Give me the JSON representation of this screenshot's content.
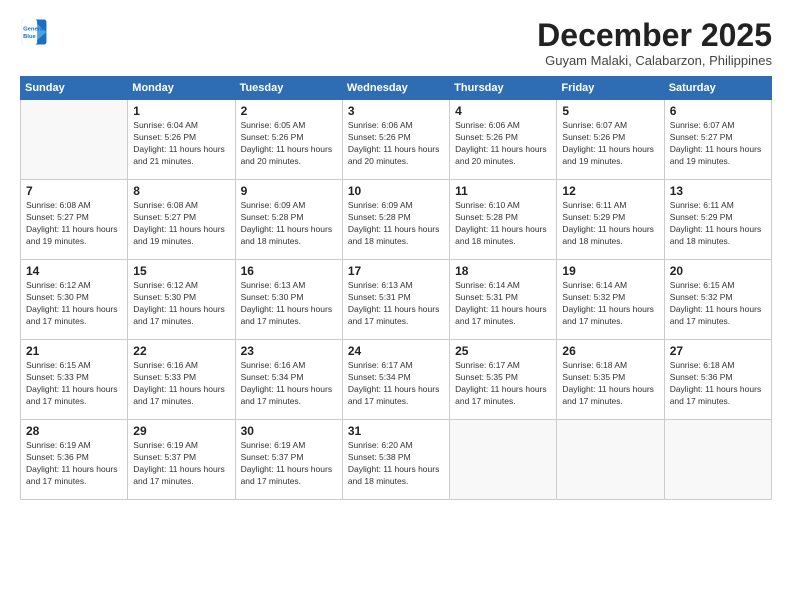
{
  "header": {
    "logo": {
      "line1": "General",
      "line2": "Blue"
    },
    "title": "December 2025",
    "location": "Guyam Malaki, Calabarzon, Philippines"
  },
  "columns": [
    "Sunday",
    "Monday",
    "Tuesday",
    "Wednesday",
    "Thursday",
    "Friday",
    "Saturday"
  ],
  "weeks": [
    [
      {
        "day": null
      },
      {
        "day": "1",
        "sunrise": "6:04 AM",
        "sunset": "5:26 PM",
        "daylight": "11 hours and 21 minutes."
      },
      {
        "day": "2",
        "sunrise": "6:05 AM",
        "sunset": "5:26 PM",
        "daylight": "11 hours and 20 minutes."
      },
      {
        "day": "3",
        "sunrise": "6:06 AM",
        "sunset": "5:26 PM",
        "daylight": "11 hours and 20 minutes."
      },
      {
        "day": "4",
        "sunrise": "6:06 AM",
        "sunset": "5:26 PM",
        "daylight": "11 hours and 20 minutes."
      },
      {
        "day": "5",
        "sunrise": "6:07 AM",
        "sunset": "5:26 PM",
        "daylight": "11 hours and 19 minutes."
      },
      {
        "day": "6",
        "sunrise": "6:07 AM",
        "sunset": "5:27 PM",
        "daylight": "11 hours and 19 minutes."
      }
    ],
    [
      {
        "day": "7",
        "sunrise": "6:08 AM",
        "sunset": "5:27 PM",
        "daylight": "11 hours and 19 minutes."
      },
      {
        "day": "8",
        "sunrise": "6:08 AM",
        "sunset": "5:27 PM",
        "daylight": "11 hours and 19 minutes."
      },
      {
        "day": "9",
        "sunrise": "6:09 AM",
        "sunset": "5:28 PM",
        "daylight": "11 hours and 18 minutes."
      },
      {
        "day": "10",
        "sunrise": "6:09 AM",
        "sunset": "5:28 PM",
        "daylight": "11 hours and 18 minutes."
      },
      {
        "day": "11",
        "sunrise": "6:10 AM",
        "sunset": "5:28 PM",
        "daylight": "11 hours and 18 minutes."
      },
      {
        "day": "12",
        "sunrise": "6:11 AM",
        "sunset": "5:29 PM",
        "daylight": "11 hours and 18 minutes."
      },
      {
        "day": "13",
        "sunrise": "6:11 AM",
        "sunset": "5:29 PM",
        "daylight": "11 hours and 18 minutes."
      }
    ],
    [
      {
        "day": "14",
        "sunrise": "6:12 AM",
        "sunset": "5:30 PM",
        "daylight": "11 hours and 17 minutes."
      },
      {
        "day": "15",
        "sunrise": "6:12 AM",
        "sunset": "5:30 PM",
        "daylight": "11 hours and 17 minutes."
      },
      {
        "day": "16",
        "sunrise": "6:13 AM",
        "sunset": "5:30 PM",
        "daylight": "11 hours and 17 minutes."
      },
      {
        "day": "17",
        "sunrise": "6:13 AM",
        "sunset": "5:31 PM",
        "daylight": "11 hours and 17 minutes."
      },
      {
        "day": "18",
        "sunrise": "6:14 AM",
        "sunset": "5:31 PM",
        "daylight": "11 hours and 17 minutes."
      },
      {
        "day": "19",
        "sunrise": "6:14 AM",
        "sunset": "5:32 PM",
        "daylight": "11 hours and 17 minutes."
      },
      {
        "day": "20",
        "sunrise": "6:15 AM",
        "sunset": "5:32 PM",
        "daylight": "11 hours and 17 minutes."
      }
    ],
    [
      {
        "day": "21",
        "sunrise": "6:15 AM",
        "sunset": "5:33 PM",
        "daylight": "11 hours and 17 minutes."
      },
      {
        "day": "22",
        "sunrise": "6:16 AM",
        "sunset": "5:33 PM",
        "daylight": "11 hours and 17 minutes."
      },
      {
        "day": "23",
        "sunrise": "6:16 AM",
        "sunset": "5:34 PM",
        "daylight": "11 hours and 17 minutes."
      },
      {
        "day": "24",
        "sunrise": "6:17 AM",
        "sunset": "5:34 PM",
        "daylight": "11 hours and 17 minutes."
      },
      {
        "day": "25",
        "sunrise": "6:17 AM",
        "sunset": "5:35 PM",
        "daylight": "11 hours and 17 minutes."
      },
      {
        "day": "26",
        "sunrise": "6:18 AM",
        "sunset": "5:35 PM",
        "daylight": "11 hours and 17 minutes."
      },
      {
        "day": "27",
        "sunrise": "6:18 AM",
        "sunset": "5:36 PM",
        "daylight": "11 hours and 17 minutes."
      }
    ],
    [
      {
        "day": "28",
        "sunrise": "6:19 AM",
        "sunset": "5:36 PM",
        "daylight": "11 hours and 17 minutes."
      },
      {
        "day": "29",
        "sunrise": "6:19 AM",
        "sunset": "5:37 PM",
        "daylight": "11 hours and 17 minutes."
      },
      {
        "day": "30",
        "sunrise": "6:19 AM",
        "sunset": "5:37 PM",
        "daylight": "11 hours and 17 minutes."
      },
      {
        "day": "31",
        "sunrise": "6:20 AM",
        "sunset": "5:38 PM",
        "daylight": "11 hours and 18 minutes."
      },
      {
        "day": null
      },
      {
        "day": null
      },
      {
        "day": null
      }
    ]
  ],
  "labels": {
    "sunrise_prefix": "Sunrise: ",
    "sunset_prefix": "Sunset: ",
    "daylight_label": "Daylight: "
  }
}
